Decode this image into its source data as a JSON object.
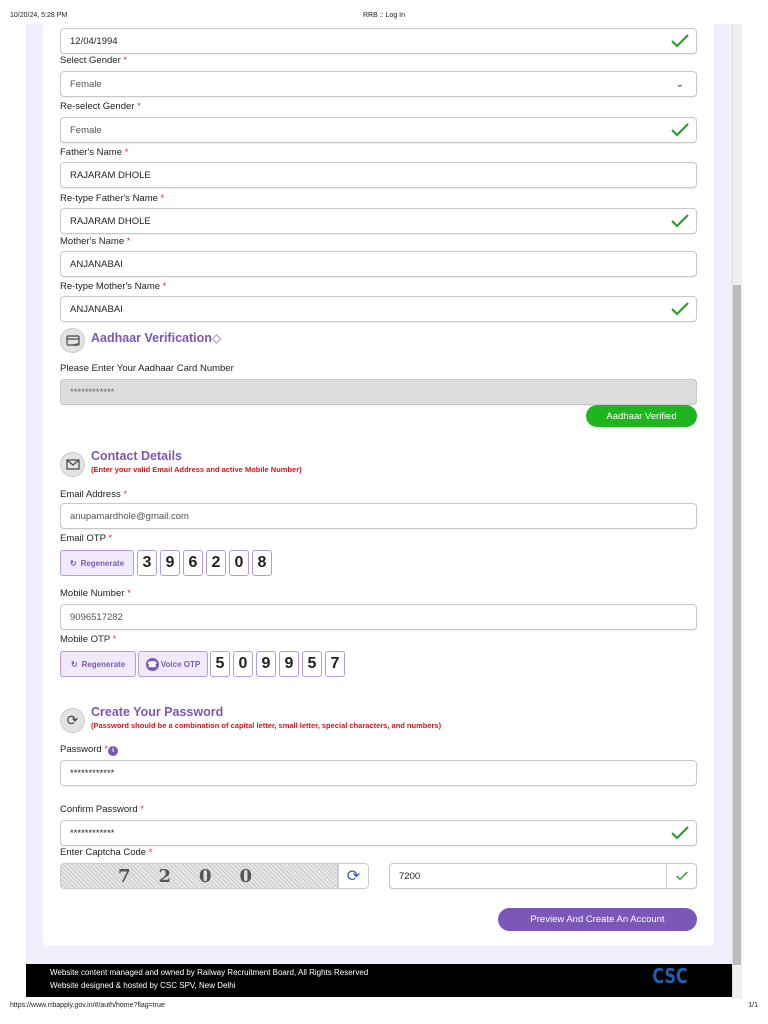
{
  "browser": {
    "timestamp": "10/20/24, 5:28 PM",
    "title": "RRB :: Log In",
    "url": "https://www.rrbapply.gov.in/#/auth/home?flag=true",
    "page": "1/1"
  },
  "fields": {
    "dob": {
      "value": "12/04/1994"
    },
    "gender": {
      "label": "Select Gender",
      "value": "Female"
    },
    "regender": {
      "label": "Re-select Gender",
      "value": "Female"
    },
    "father": {
      "label": "Father's Name",
      "value": "RAJARAM DHOLE"
    },
    "refather": {
      "label": "Re-type Father's Name",
      "value": "RAJARAM DHOLE"
    },
    "mother": {
      "label": "Mother's Name",
      "value": "ANJANABAI"
    },
    "remother": {
      "label": "Re-type Mother's Name",
      "value": "ANJANABAI"
    }
  },
  "aadhaar": {
    "heading": "Aadhaar Verification",
    "label": "Please Enter Your Aadhaar Card Number",
    "value": "************",
    "verified_label": "Aadhaar Verified"
  },
  "contact": {
    "heading": "Contact Details",
    "subtitle": "(Enter your valid Email Address and active Mobile Number)",
    "email_label": "Email Address",
    "email": "anupamardhole@gmail.com",
    "email_otp_label": "Email OTP",
    "regenerate": "Regenerate",
    "email_otp": [
      "3",
      "9",
      "6",
      "2",
      "0",
      "8"
    ],
    "mobile_label": "Mobile Number",
    "mobile": "9096517282",
    "mobile_otp_label": "Mobile OTP",
    "voice_otp": "Voice OTP",
    "mobile_otp": [
      "5",
      "0",
      "9",
      "9",
      "5",
      "7"
    ]
  },
  "password": {
    "heading": "Create Your Password",
    "subtitle": "(Password should be a combination of capital letter, small letter, special characters, and numbers)",
    "password_label": "Password",
    "password": "************",
    "confirm_label": "Confirm Password",
    "confirm": "************",
    "captcha_label": "Enter Captcha Code",
    "captcha_image_text": "7200",
    "captcha_value": "7200"
  },
  "submit": "Preview And Create An Account",
  "footer": {
    "line1": "Website content managed and owned by Railway Recruitment Board, All Rights Reserved",
    "line2": "Website designed & hosted by CSC SPV,  New Delhi",
    "logo": "CSC"
  },
  "colors": {
    "accent": "#7b58b7",
    "success": "#1fb51f",
    "error": "#d9141a"
  },
  "required_mark": "*"
}
